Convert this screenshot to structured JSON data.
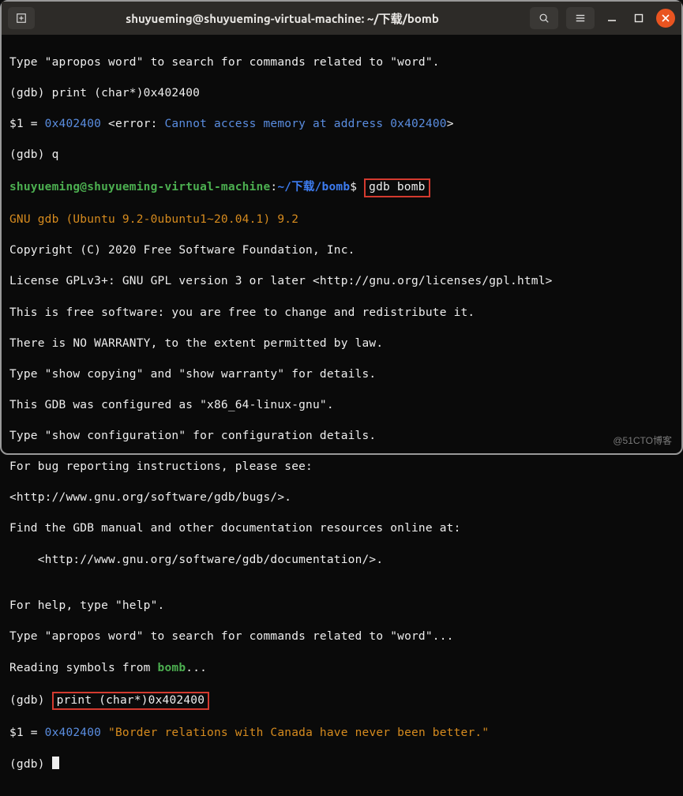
{
  "window": {
    "title": "shuyueming@shuyueming-virtual-machine: ~/下载/bomb"
  },
  "terminal": {
    "l1": "Type \"apropos word\" to search for commands related to \"word\".",
    "l2": "(gdb) print (char*)0x402400",
    "l3a": "$1 = ",
    "l3b": "0x402400",
    "l3c": " <error: ",
    "l3d": "Cannot access memory at address 0x402400",
    "l3e": ">",
    "l4": "(gdb) q",
    "prompt_user": "shuyueming@shuyueming-virtual-machine",
    "prompt_colon": ":",
    "prompt_path": "~/下载/bomb",
    "prompt_dollar": "$ ",
    "cmd1": "gdb bomb",
    "l6": "GNU gdb (Ubuntu 9.2-0ubuntu1~20.04.1) 9.2",
    "l7": "Copyright (C) 2020 Free Software Foundation, Inc.",
    "l8": "License GPLv3+: GNU GPL version 3 or later <http://gnu.org/licenses/gpl.html>",
    "l9": "This is free software: you are free to change and redistribute it.",
    "l10": "There is NO WARRANTY, to the extent permitted by law.",
    "l11": "Type \"show copying\" and \"show warranty\" for details.",
    "l12": "This GDB was configured as \"x86_64-linux-gnu\".",
    "l13": "Type \"show configuration\" for configuration details.",
    "l14": "For bug reporting instructions, please see:",
    "l15": "<http://www.gnu.org/software/gdb/bugs/>.",
    "l16": "Find the GDB manual and other documentation resources online at:",
    "l17": "    <http://www.gnu.org/software/gdb/documentation/>.",
    "l18": "",
    "l19": "For help, type \"help\".",
    "l20": "Type \"apropos word\" to search for commands related to \"word\"...",
    "l21a": "Reading symbols from ",
    "l21b": "bomb",
    "l21c": "...",
    "l22a": "(gdb) ",
    "l22b": "print (char*)0x402400",
    "l23a": "$1 = ",
    "l23b": "0x402400",
    "l23c": " \"Border relations with Canada have never been better.\"",
    "l24": "(gdb) "
  },
  "watermark": "@51CTO博客"
}
